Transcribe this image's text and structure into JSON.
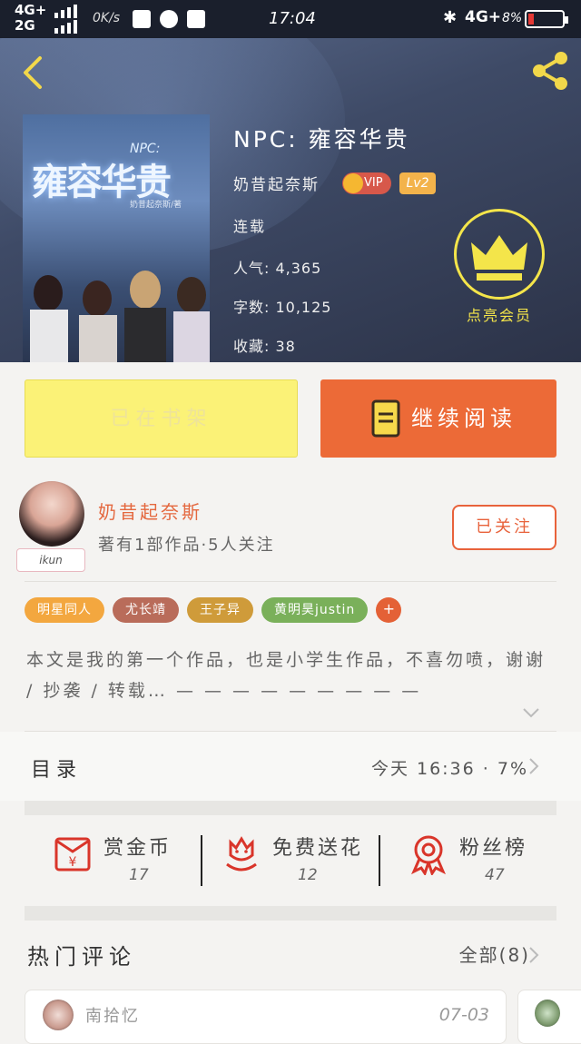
{
  "status_bar": {
    "network_top": "4G+",
    "network_bottom": "2G",
    "speed": "0K/s",
    "time": "17:04",
    "bluetooth_icon": "bluetooth-icon",
    "network_right": "4G+",
    "battery": "8%"
  },
  "header": {
    "back_icon": "back-arrow-icon",
    "share_icon": "share-icon"
  },
  "book": {
    "title": "NPC: 雍容华贵",
    "author": "奶昔起奈斯",
    "vip_label": "VIP",
    "level": "Lv2",
    "status": "连载",
    "popularity": "人气: 4,365",
    "word_count": "字数: 10,125",
    "favorites": "收藏: 38",
    "cover": {
      "title": "雍容华贵",
      "npc": "NPC:",
      "author": "奶昔起奈斯/著"
    }
  },
  "member": {
    "label": "点亮会员",
    "icon": "crown-icon"
  },
  "actions": {
    "shelf": "已在书架",
    "read": "继续阅读"
  },
  "author_card": {
    "name": "奶昔起奈斯",
    "subtitle": "著有1部作品·5人关注",
    "badge": "ikun",
    "follow": "已关注"
  },
  "tags": [
    {
      "label": "明星同人",
      "color": "#f3a73f"
    },
    {
      "label": "尤长靖",
      "color": "#b96c5a"
    },
    {
      "label": "王子异",
      "color": "#cf9b3a"
    },
    {
      "label": "黄明昊justin",
      "color": "#7ab05a"
    }
  ],
  "tag_more": "+",
  "description": "本文是我的第一个作品，也是小学生作品，不喜勿喷，谢谢 / 抄袭 / 转载… — — — — — — — — —",
  "toc": {
    "label": "目录",
    "value": "今天 16:36 · 7%"
  },
  "stats": [
    {
      "label": "赏金币",
      "value": "17",
      "icon": "red-envelope-icon"
    },
    {
      "label": "免费送花",
      "value": "12",
      "icon": "flower-icon"
    },
    {
      "label": "粉丝榜",
      "value": "47",
      "icon": "medal-icon"
    }
  ],
  "comments": {
    "title": "热门评论",
    "all": "全部(8)",
    "items": [
      {
        "name": "南拾忆",
        "date": "07-03"
      }
    ]
  },
  "colors": {
    "accent": "#ec6a37",
    "shelf_button": "#fbf277",
    "member_yellow": "#f4e54a"
  }
}
